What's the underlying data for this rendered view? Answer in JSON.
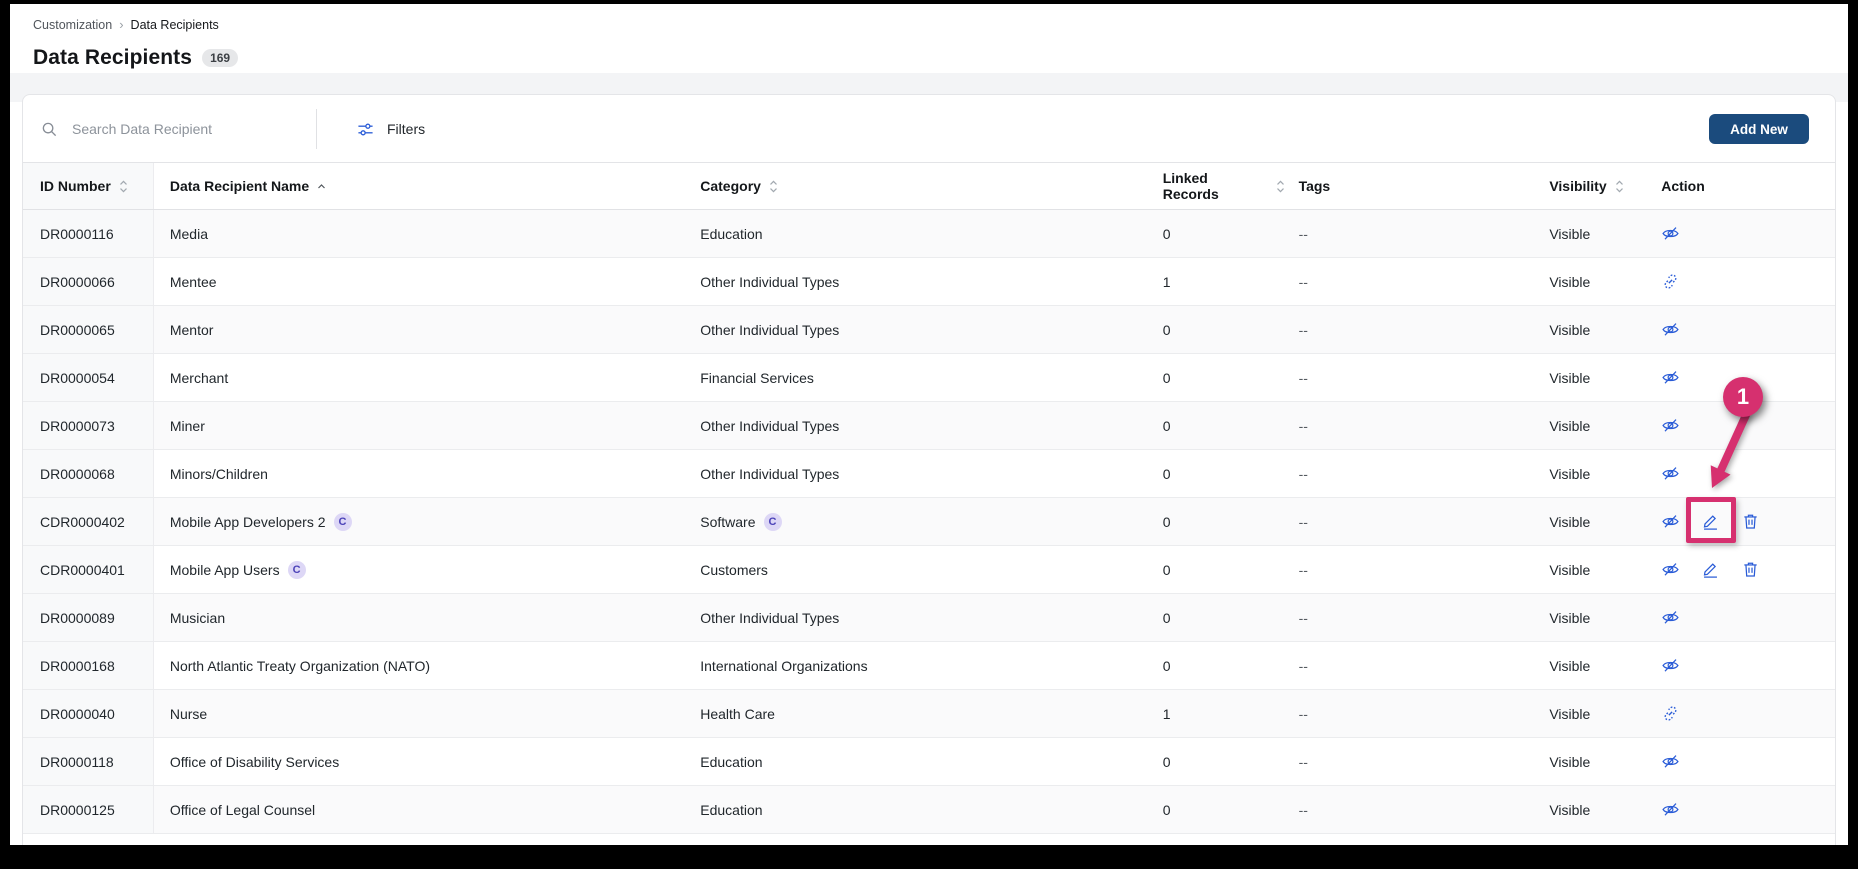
{
  "breadcrumb": {
    "items": [
      "Customization",
      "Data Recipients"
    ],
    "separator": "›"
  },
  "header": {
    "title": "Data Recipients",
    "count": "169"
  },
  "toolbar": {
    "search_placeholder": "Search Data Recipient",
    "filters_label": "Filters",
    "add_new_label": "Add New"
  },
  "table": {
    "custom_badge": "C",
    "columns": [
      {
        "key": "id",
        "label": "ID Number",
        "sort": "both"
      },
      {
        "key": "name",
        "label": "Data Recipient Name",
        "sort": "asc"
      },
      {
        "key": "category",
        "label": "Category",
        "sort": "both"
      },
      {
        "key": "linked",
        "label": "Linked Records",
        "sort": "both"
      },
      {
        "key": "tags",
        "label": "Tags",
        "sort": "none"
      },
      {
        "key": "visibility",
        "label": "Visibility",
        "sort": "both"
      },
      {
        "key": "action",
        "label": "Action",
        "sort": "none"
      }
    ],
    "rows": [
      {
        "id": "DR0000116",
        "name": "Media",
        "name_custom": false,
        "category": "Education",
        "category_custom": false,
        "linked": "0",
        "tags": "--",
        "visibility": "Visible",
        "actions": [
          "hide"
        ]
      },
      {
        "id": "DR0000066",
        "name": "Mentee",
        "name_custom": false,
        "category": "Other Individual Types",
        "category_custom": false,
        "linked": "1",
        "tags": "--",
        "visibility": "Visible",
        "actions": [
          "unlink"
        ]
      },
      {
        "id": "DR0000065",
        "name": "Mentor",
        "name_custom": false,
        "category": "Other Individual Types",
        "category_custom": false,
        "linked": "0",
        "tags": "--",
        "visibility": "Visible",
        "actions": [
          "hide"
        ]
      },
      {
        "id": "DR0000054",
        "name": "Merchant",
        "name_custom": false,
        "category": "Financial Services",
        "category_custom": false,
        "linked": "0",
        "tags": "--",
        "visibility": "Visible",
        "actions": [
          "hide"
        ]
      },
      {
        "id": "DR0000073",
        "name": "Miner",
        "name_custom": false,
        "category": "Other Individual Types",
        "category_custom": false,
        "linked": "0",
        "tags": "--",
        "visibility": "Visible",
        "actions": [
          "hide"
        ]
      },
      {
        "id": "DR0000068",
        "name": "Minors/Children",
        "name_custom": false,
        "category": "Other Individual Types",
        "category_custom": false,
        "linked": "0",
        "tags": "--",
        "visibility": "Visible",
        "actions": [
          "hide"
        ]
      },
      {
        "id": "CDR0000402",
        "name": "Mobile App Developers 2",
        "name_custom": true,
        "category": "Software",
        "category_custom": true,
        "linked": "0",
        "tags": "--",
        "visibility": "Visible",
        "actions": [
          "hide",
          "edit",
          "delete"
        ],
        "highlight_edit": true
      },
      {
        "id": "CDR0000401",
        "name": "Mobile App Users",
        "name_custom": true,
        "category": "Customers",
        "category_custom": false,
        "linked": "0",
        "tags": "--",
        "visibility": "Visible",
        "actions": [
          "hide",
          "edit",
          "delete"
        ]
      },
      {
        "id": "DR0000089",
        "name": "Musician",
        "name_custom": false,
        "category": "Other Individual Types",
        "category_custom": false,
        "linked": "0",
        "tags": "--",
        "visibility": "Visible",
        "actions": [
          "hide"
        ]
      },
      {
        "id": "DR0000168",
        "name": "North Atlantic Treaty Organization (NATO)",
        "name_custom": false,
        "category": "International Organizations",
        "category_custom": false,
        "linked": "0",
        "tags": "--",
        "visibility": "Visible",
        "actions": [
          "hide"
        ]
      },
      {
        "id": "DR0000040",
        "name": "Nurse",
        "name_custom": false,
        "category": "Health Care",
        "category_custom": false,
        "linked": "1",
        "tags": "--",
        "visibility": "Visible",
        "actions": [
          "unlink"
        ]
      },
      {
        "id": "DR0000118",
        "name": "Office of Disability Services",
        "name_custom": false,
        "category": "Education",
        "category_custom": false,
        "linked": "0",
        "tags": "--",
        "visibility": "Visible",
        "actions": [
          "hide"
        ]
      },
      {
        "id": "DR0000125",
        "name": "Office of Legal Counsel",
        "name_custom": false,
        "category": "Education",
        "category_custom": false,
        "linked": "0",
        "tags": "--",
        "visibility": "Visible",
        "actions": [
          "hide"
        ]
      }
    ]
  },
  "annotation": {
    "label": "1"
  },
  "colors": {
    "icon_blue": "#2a5cd7",
    "navy_button": "#1b4b7d",
    "annotation_pink": "#d6306f",
    "custom_badge_bg": "#ddd7f6",
    "custom_badge_text": "#4b42b8"
  }
}
